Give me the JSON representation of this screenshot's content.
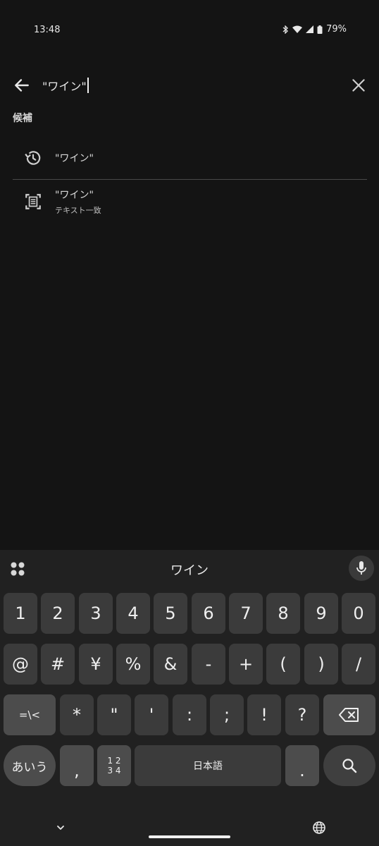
{
  "status_bar": {
    "time": "13:48",
    "battery": "79%"
  },
  "search": {
    "query": "\"ワイン\""
  },
  "suggestions": {
    "section_label": "候補",
    "items": [
      {
        "title": "\"ワイン\"",
        "icon": "history-icon"
      },
      {
        "title": "\"ワイン\"",
        "subtitle": "テキスト一致",
        "icon": "text-scan-icon"
      }
    ]
  },
  "keyboard": {
    "candidate": "ワイン",
    "row1": [
      "1",
      "2",
      "3",
      "4",
      "5",
      "6",
      "7",
      "8",
      "9",
      "0"
    ],
    "row2": [
      "@",
      "#",
      "¥",
      "%",
      "&",
      "-",
      "+",
      "(",
      ")",
      "/"
    ],
    "row3": [
      "=\\<",
      "*",
      "\"",
      "'",
      ":",
      ";",
      "!",
      "?"
    ],
    "row4": {
      "lang": "あいう",
      "comma": ",",
      "num_top": "1 2",
      "num_bottom": "3 4",
      "space": "日本語",
      "period": "."
    }
  },
  "colors": {
    "background": "#141414",
    "keyboard": "#212121",
    "key": "#3b3b3b"
  }
}
